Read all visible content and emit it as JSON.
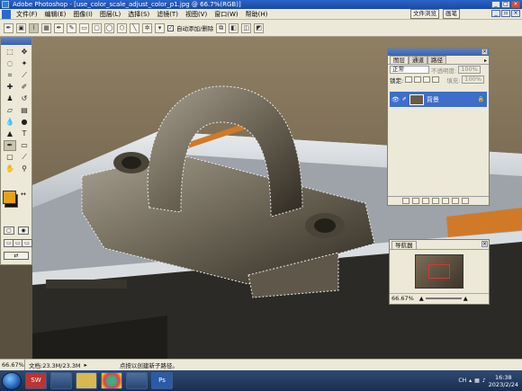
{
  "window": {
    "title": "Adobe Photoshop - [use_color_scale_adjust_color_p1.jpg @ 66.7%(RGB)]",
    "buttons": [
      "_",
      "□",
      "×"
    ]
  },
  "menubar": {
    "items": [
      "文件(F)",
      "编辑(E)",
      "图像(I)",
      "图层(L)",
      "选择(S)",
      "滤镜(T)",
      "视图(V)",
      "窗口(W)",
      "帮助(H)"
    ],
    "workspace_tabs": [
      "文件浏览",
      "画笔"
    ]
  },
  "options": {
    "auto_add_label": "自动添加/删除",
    "auto_add_checked": "✓"
  },
  "tools": {
    "colors": {
      "foreground": "#e4a21c",
      "background": "#111111"
    }
  },
  "layers_panel": {
    "tabs": [
      "图层",
      "通道",
      "路径"
    ],
    "blend_mode": "正常",
    "opacity_label": "不透明度:",
    "opacity_value": "100%",
    "lock_label": "锁定:",
    "fill_label": "填充:",
    "fill_value": "100%",
    "layer_name": "背景",
    "selected_color": "#3d6ec9"
  },
  "navigator_panel": {
    "tab": "导航器",
    "zoom": "66.67%"
  },
  "statusbar": {
    "zoom": "66.67%",
    "doc": "文档:23.3M/23.3M",
    "hint": "点按以创建新子路径。"
  },
  "taskbar": {
    "apps": [
      "SW",
      "",
      "",
      "",
      "",
      "Ps"
    ],
    "lang": "CH",
    "time": "16:38",
    "date": "2023/2/24"
  }
}
